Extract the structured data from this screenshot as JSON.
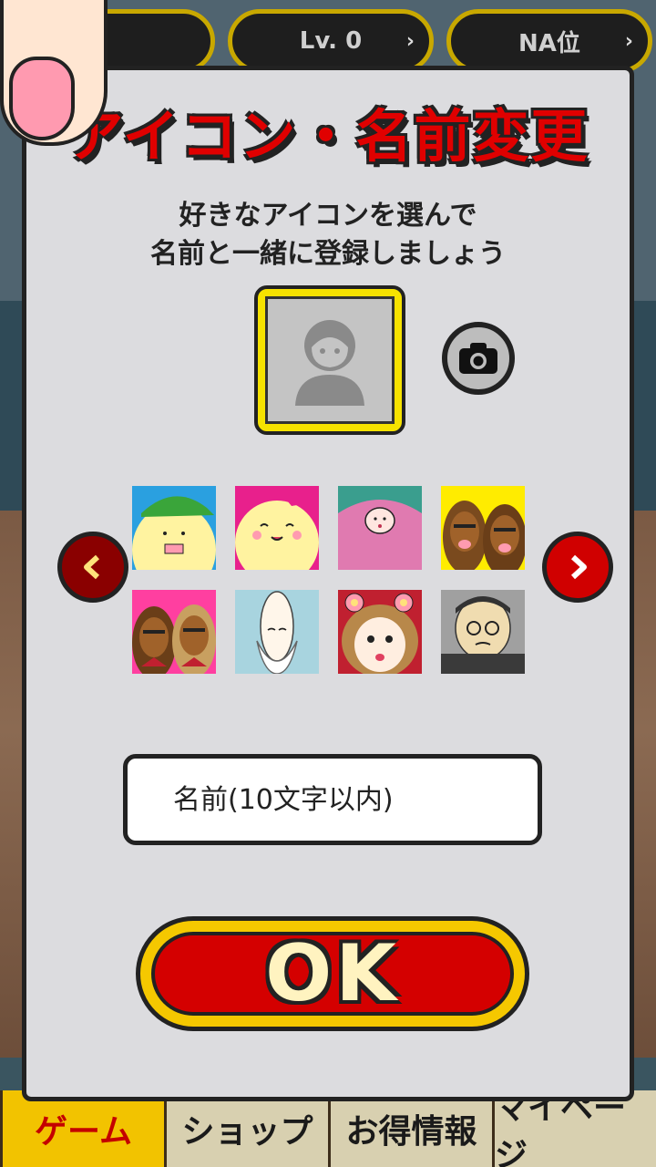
{
  "top_bar": {
    "level_label": "Lv. 0",
    "rank_label": "NA位"
  },
  "modal": {
    "title": "アイコン・名前変更",
    "subtitle_line1": "好きなアイコンを選んで",
    "subtitle_line2": "名前と一緒に登録しましょう",
    "name_input_placeholder": "名前(10文字以内)",
    "ok_label": "OK",
    "icons": [
      {
        "name": "icon-boy-green-cap",
        "bg": "#fff3a0",
        "accent": "#3aa53a"
      },
      {
        "name": "icon-girl-bow",
        "bg": "#fff3a0",
        "accent": "#e8208c"
      },
      {
        "name": "icon-pink-monster",
        "bg": "#e07ab0",
        "accent": "#3a9e8e"
      },
      {
        "name": "icon-tan-girls-yellow",
        "bg": "#ffec00",
        "accent": "#7a4a1e"
      },
      {
        "name": "icon-tan-girls-pink",
        "bg": "#ff3fa0",
        "accent": "#7a4a1e"
      },
      {
        "name": "icon-old-man-beard",
        "bg": "#a8d4df",
        "accent": "#ffffff"
      },
      {
        "name": "icon-flower-girl",
        "bg": "#c02030",
        "accent": "#ff9bb0"
      },
      {
        "name": "icon-man-glasses",
        "bg": "#a0a0a0",
        "accent": "#3a3a3a"
      }
    ]
  },
  "tabs": [
    {
      "label": "ゲーム",
      "active": true
    },
    {
      "label": "ショップ",
      "active": false
    },
    {
      "label": "お得情報",
      "active": false
    },
    {
      "label": "マイページ",
      "active": false
    }
  ],
  "colors": {
    "title_red": "#e00000",
    "ok_red": "#d40000",
    "ok_border": "#f5c800",
    "avatar_border": "#f6e200"
  }
}
